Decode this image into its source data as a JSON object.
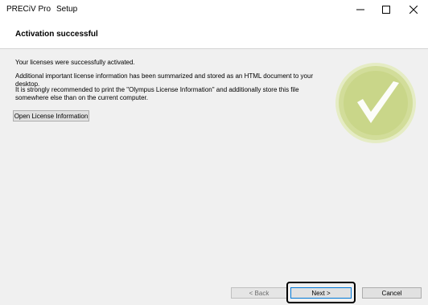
{
  "window": {
    "app_title": "PRECiV Pro",
    "setup_title": "Setup"
  },
  "header": {
    "title": "Activation successful"
  },
  "content": {
    "line1": "Your licenses were successfully activated.",
    "line2": "Additional important license information has been summarized and stored as an HTML document to your desktop.",
    "line3": "It is strongly recommended to print the \"Olympus License Information\" and additionally store this file somewhere else than on the current computer.",
    "open_button": "Open License Information"
  },
  "footer": {
    "back": "< Back",
    "next": "Next >",
    "cancel": "Cancel"
  },
  "colors": {
    "success_outer": "#dfe7b3",
    "success_inner": "#cdd98f",
    "check": "#ffffff"
  }
}
